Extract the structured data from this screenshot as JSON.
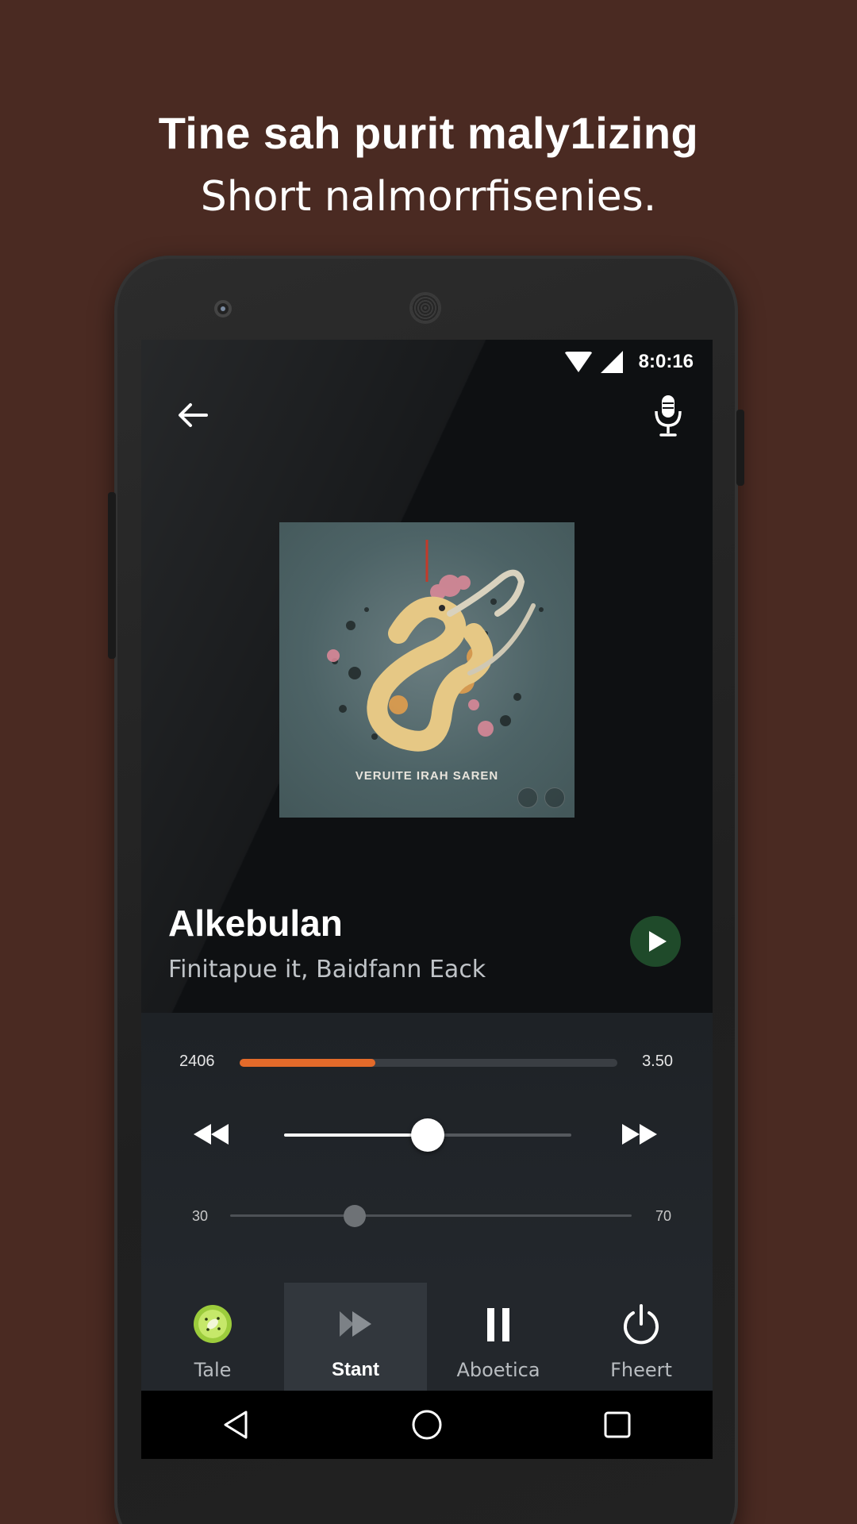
{
  "headline": {
    "line1": "Tine sah purit maly1izing",
    "line2": "Short nalmorrfisenies."
  },
  "status_bar": {
    "time": "8:0:16"
  },
  "album": {
    "cover_text": "VERUITE IRAH SAREN"
  },
  "track": {
    "title": "Alkebulan",
    "artist": "Finitapue it, Baidfann Eack"
  },
  "playback": {
    "elapsed": "2406",
    "total": "3.50",
    "progress_fraction": 0.36,
    "seek_fraction": 0.5
  },
  "volume": {
    "min_label": "30",
    "max_label": "70",
    "fraction": 0.31
  },
  "tabs": [
    {
      "label": "Tale",
      "icon": "kiwi-icon",
      "active": false
    },
    {
      "label": "Stant",
      "icon": "forward-icon",
      "active": true
    },
    {
      "label": "Aboetica",
      "icon": "pause-icon",
      "active": false
    },
    {
      "label": "Fheert",
      "icon": "power-icon",
      "active": false
    }
  ],
  "colors": {
    "background": "#4a2a22",
    "progress_accent": "#e36a2a",
    "play_button": "#1f4a2a",
    "kiwi_green": "#9ccc3c"
  }
}
